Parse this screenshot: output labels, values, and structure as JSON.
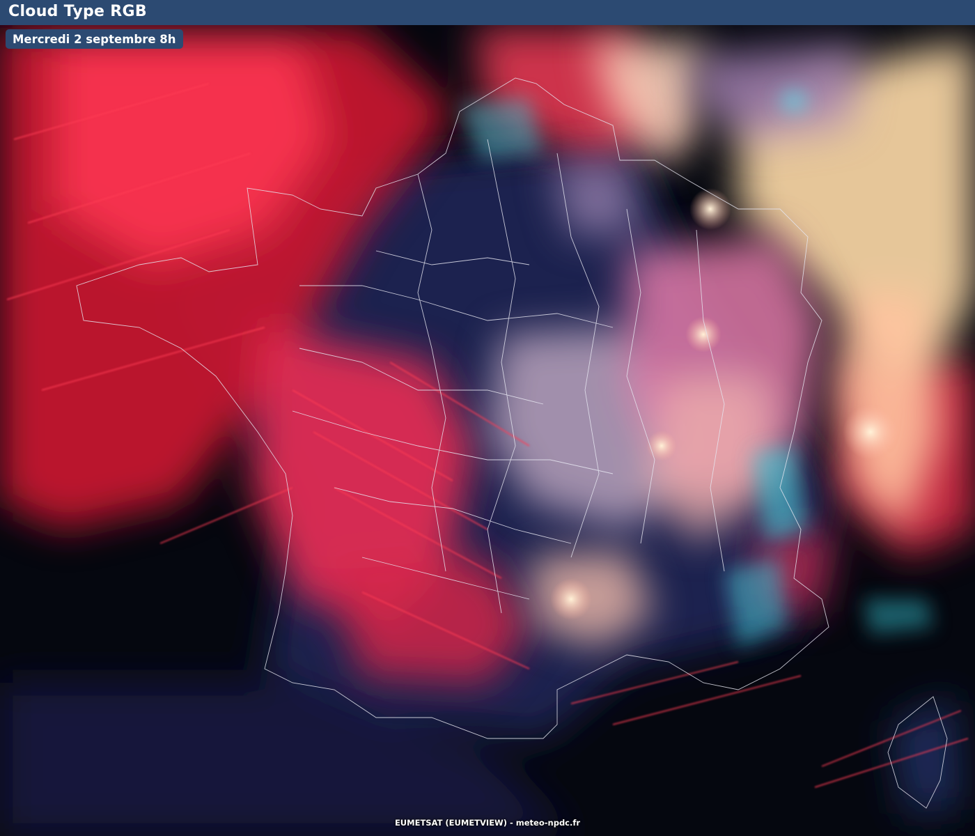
{
  "header": {
    "title": "Cloud Type RGB"
  },
  "date_badge": {
    "label": "Mercredi 2 septembre 8h"
  },
  "footer": {
    "credit": "EUMETSAT (EUMETVIEW) - meteo-npdc.fr"
  },
  "colors": {
    "header_bg": "#2c4a72",
    "ice_cloud": "#e0243f",
    "high_thick_cloud": "#ffd9b8",
    "mixed_cloud": "#d86aa6",
    "low_water_cloud": "#6fd6e8",
    "clear_land": "#1a2348",
    "sea": "#04060e",
    "borders": "#e6e6f0"
  }
}
